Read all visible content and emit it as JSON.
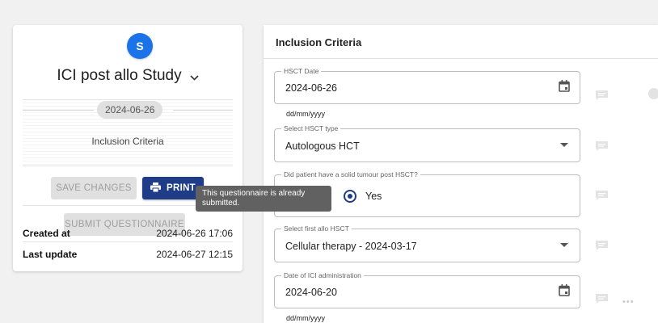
{
  "sidebar": {
    "avatar_letter": "S",
    "study_title": "ICI post allo Study",
    "date": "2024-06-26",
    "section": "Inclusion Criteria",
    "save_label": "SAVE CHANGES",
    "print_label": "PRINT",
    "submit_label": "SUBMIT QUESTIONNAIRE",
    "created_label": "Created at",
    "created_value": "2024-06-26 17:06",
    "updated_label": "Last update",
    "updated_value": "2024-06-27 12:15"
  },
  "tooltip": {
    "text": "This questionnaire is already submitted."
  },
  "form": {
    "title": "Inclusion Criteria",
    "hsct_date": {
      "label": "HSCT Date",
      "value": "2024-06-26",
      "hint": "dd/mm/yyyy"
    },
    "hsct_type": {
      "label": "Select HSCT type",
      "value": "Autologous HCT"
    },
    "solid_tumour": {
      "label": "Did patient have a solid tumour post HSCT?",
      "value": "Yes"
    },
    "first_allo": {
      "label": "Select first allo HSCT",
      "value": "Cellular therapy - 2024-03-17"
    },
    "ici_date": {
      "label": "Date of ICI administration",
      "value": "2024-06-20",
      "hint": "dd/mm/yyyy"
    }
  },
  "colors": {
    "primary": "#1f3c88",
    "avatar": "#1a73e8",
    "tooltip": "#616161"
  },
  "icons": [
    "calendar-icon",
    "dropdown-arrow-icon",
    "comment-icon",
    "print-icon",
    "chevron-down-icon",
    "more-icon"
  ]
}
